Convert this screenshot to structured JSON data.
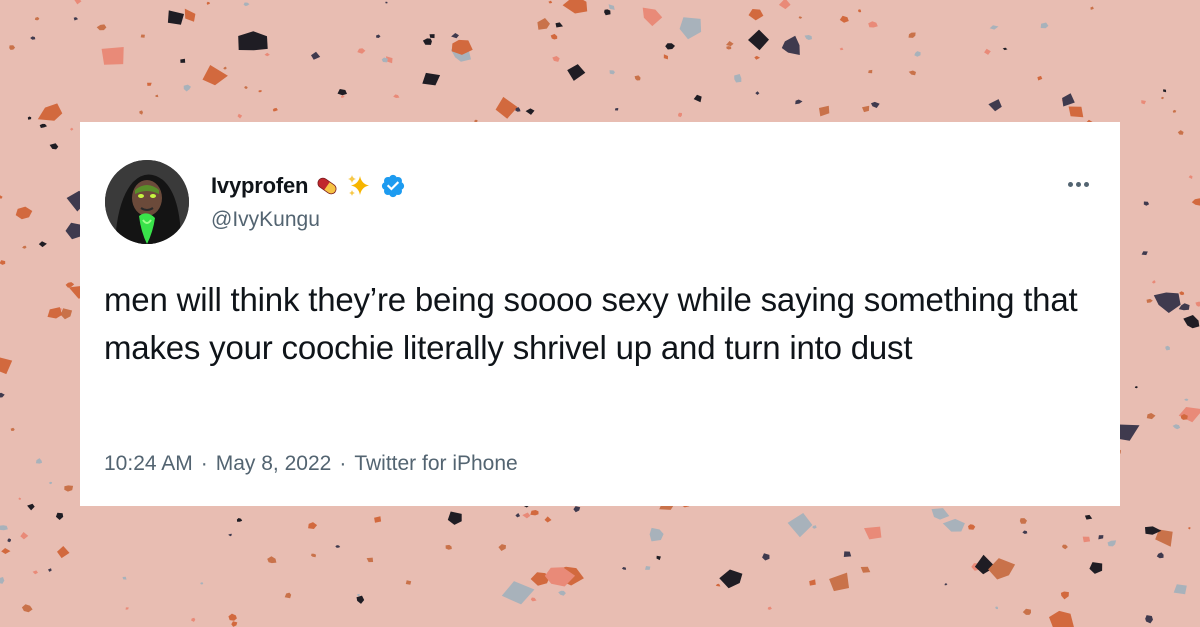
{
  "tweet": {
    "display_name": "Ivyprofen",
    "name_emojis": [
      "pill-emoji",
      "sparkles-emoji"
    ],
    "verified": true,
    "handle": "@IvyKungu",
    "text": "men will think they’re being soooo sexy while saying something that makes your coochie literally shrivel up and turn into dust",
    "time": "10:24 AM",
    "date": "May 8, 2022",
    "source": "Twitter for iPhone",
    "separator": "·",
    "more_icon": "more-horizontal-icon"
  },
  "colors": {
    "background": "#e8bdb2",
    "card": "#ffffff",
    "text_primary": "#0f1419",
    "text_secondary": "#536471",
    "verified_blue": "#1d9bf0",
    "chip_colors": [
      "#3f3a4e",
      "#d2693e",
      "#a8b2bb",
      "#e98a78",
      "#1f1d24",
      "#c9724a"
    ]
  }
}
